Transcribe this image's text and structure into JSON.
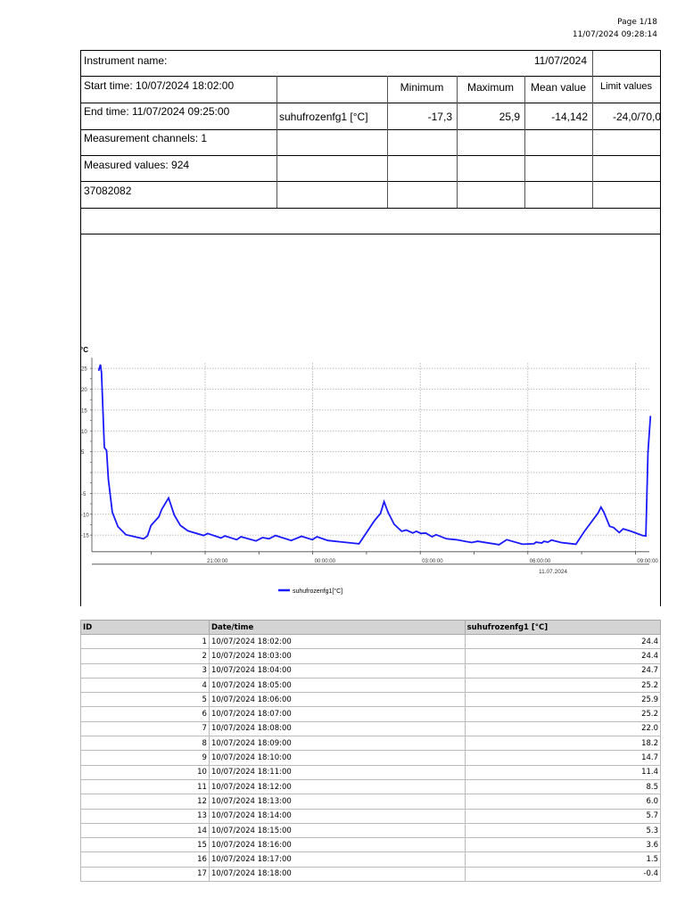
{
  "header": {
    "page": "Page 1/18",
    "printed": "11/07/2024 09:28:14"
  },
  "summary": {
    "instrument_label": "Instrument name:",
    "date": "11/07/2024",
    "start_time": "Start time: 10/07/2024 18:02:00",
    "end_time": "End time: 11/07/2024 09:25:00",
    "channels": "Measurement channels: 1",
    "measured_values": "Measured values: 924",
    "serial": "37082082",
    "columns": {
      "min": "Minimum",
      "max": "Maximum",
      "mean": "Mean value",
      "limits": "Limit values"
    },
    "channel": {
      "name": "suhufrozenfg1 [°C]",
      "min": "-17,3",
      "max": "25,9",
      "mean": "-14,142",
      "limits": "-24,0/70,0"
    }
  },
  "chart_data": {
    "type": "line",
    "ylabel": "°C",
    "ylim": [
      -19,
      28
    ],
    "yticks": [
      25,
      20,
      15,
      10,
      5,
      -5,
      -10,
      -15
    ],
    "x_unit": "hours since 10/07/2024 18:00",
    "xlim": [
      0,
      15.42
    ],
    "xticks": [
      {
        "t": 3,
        "label": "21:00:00"
      },
      {
        "t": 6,
        "label": "00:00:00"
      },
      {
        "t": 9,
        "label": "03:00:00"
      },
      {
        "t": 12,
        "label": "06:00:00"
      },
      {
        "t": 15,
        "label": "09:00:00"
      }
    ],
    "date_label": "11.07.2024",
    "legend": "suhufrozenfg1[°C]",
    "color": "#1a1aff",
    "series": [
      {
        "name": "suhufrozenfg1[°C]",
        "x": [
          0.03,
          0.08,
          0.11,
          0.19,
          0.25,
          0.3,
          0.41,
          0.57,
          0.79,
          1.28,
          1.39,
          1.49,
          1.71,
          1.79,
          1.98,
          2.14,
          2.31,
          2.52,
          2.96,
          3.07,
          3.44,
          3.55,
          3.88,
          4.0,
          4.42,
          4.6,
          4.78,
          4.96,
          5.4,
          5.69,
          5.99,
          6.12,
          6.42,
          7.29,
          7.72,
          7.89,
          7.99,
          8.1,
          8.27,
          8.48,
          8.61,
          8.79,
          8.89,
          9.02,
          9.15,
          9.33,
          9.44,
          9.73,
          10.0,
          10.43,
          10.6,
          11.2,
          11.41,
          11.85,
          12.17,
          12.23,
          12.39,
          12.45,
          12.56,
          12.66,
          12.93,
          13.34,
          13.58,
          13.96,
          14.04,
          14.12,
          14.28,
          14.39,
          14.55,
          14.66,
          14.88,
          15.2,
          15.29,
          15.35,
          15.42
        ],
        "y": [
          24.4,
          25.9,
          24.0,
          6.0,
          5.3,
          -1.6,
          -9.5,
          -13.0,
          -14.9,
          -15.9,
          -15.2,
          -12.7,
          -10.6,
          -8.8,
          -6.1,
          -10.2,
          -12.7,
          -14.0,
          -15.1,
          -14.6,
          -15.7,
          -15.2,
          -16.1,
          -15.4,
          -16.4,
          -15.6,
          -15.9,
          -15.1,
          -16.3,
          -15.3,
          -16.1,
          -15.4,
          -16.3,
          -17.1,
          -11.6,
          -9.8,
          -7.0,
          -9.5,
          -12.4,
          -14.1,
          -13.8,
          -14.5,
          -14.1,
          -14.6,
          -14.5,
          -15.4,
          -14.9,
          -15.9,
          -16.1,
          -16.8,
          -16.5,
          -17.3,
          -16.1,
          -17.2,
          -17.1,
          -16.7,
          -16.9,
          -16.5,
          -16.7,
          -16.2,
          -16.8,
          -17.2,
          -14.1,
          -9.7,
          -8.3,
          -9.5,
          -12.9,
          -13.2,
          -14.4,
          -13.5,
          -14.1,
          -15.1,
          -15.2,
          4.9,
          13.6
        ]
      }
    ]
  },
  "table": {
    "headers": [
      "ID",
      "Date/time",
      "suhufrozenfg1 [°C]"
    ],
    "rows": [
      [
        "1",
        "10/07/2024 18:02:00",
        "24.4"
      ],
      [
        "2",
        "10/07/2024 18:03:00",
        "24.4"
      ],
      [
        "3",
        "10/07/2024 18:04:00",
        "24.7"
      ],
      [
        "4",
        "10/07/2024 18:05:00",
        "25.2"
      ],
      [
        "5",
        "10/07/2024 18:06:00",
        "25.9"
      ],
      [
        "6",
        "10/07/2024 18:07:00",
        "25.2"
      ],
      [
        "7",
        "10/07/2024 18:08:00",
        "22.0"
      ],
      [
        "8",
        "10/07/2024 18:09:00",
        "18.2"
      ],
      [
        "9",
        "10/07/2024 18:10:00",
        "14.7"
      ],
      [
        "10",
        "10/07/2024 18:11:00",
        "11.4"
      ],
      [
        "11",
        "10/07/2024 18:12:00",
        "8.5"
      ],
      [
        "12",
        "10/07/2024 18:13:00",
        "6.0"
      ],
      [
        "13",
        "10/07/2024 18:14:00",
        "5.7"
      ],
      [
        "14",
        "10/07/2024 18:15:00",
        "5.3"
      ],
      [
        "15",
        "10/07/2024 18:16:00",
        "3.6"
      ],
      [
        "16",
        "10/07/2024 18:17:00",
        "1.5"
      ],
      [
        "17",
        "10/07/2024 18:18:00",
        "-0.4"
      ]
    ]
  }
}
